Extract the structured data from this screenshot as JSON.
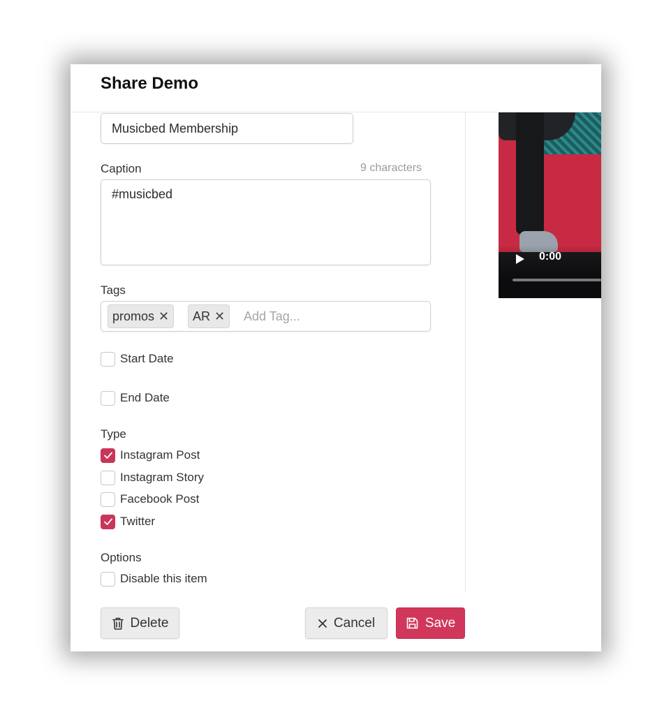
{
  "dialog": {
    "title": "Share Demo"
  },
  "form": {
    "title_value": "Musicbed Membership",
    "caption": {
      "label": "Caption",
      "counter": "9 characters",
      "value": "#musicbed"
    },
    "tags": {
      "label": "Tags",
      "items": [
        {
          "label": "promos"
        },
        {
          "label": "AR"
        }
      ],
      "placeholder": "Add Tag..."
    },
    "dates": {
      "start_label": "Start Date",
      "start_checked": false,
      "end_label": "End Date",
      "end_checked": false
    },
    "type": {
      "label": "Type",
      "options": [
        {
          "label": "Instagram Post",
          "checked": true
        },
        {
          "label": "Instagram Story",
          "checked": false
        },
        {
          "label": "Facebook Post",
          "checked": false
        },
        {
          "label": "Twitter",
          "checked": true
        }
      ]
    },
    "options": {
      "label": "Options",
      "disable_label": "Disable this item",
      "disable_checked": false
    }
  },
  "footer": {
    "delete_label": "Delete",
    "cancel_label": "Cancel",
    "save_label": "Save"
  },
  "video": {
    "time": "0:00",
    "progress": 0
  },
  "colors": {
    "accent": "#d0375b",
    "checkbox_checked": "#c9365a"
  },
  "icons": {
    "delete": "trash-icon",
    "cancel": "close-icon",
    "save": "floppy-disk-icon",
    "tag_remove": "close-icon",
    "play": "play-icon",
    "checkmark": "checkmark-icon"
  }
}
